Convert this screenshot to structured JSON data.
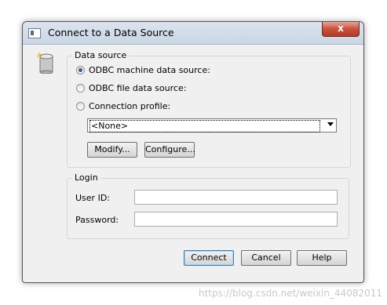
{
  "window": {
    "title": "Connect to a Data Source",
    "close_glyph": "x"
  },
  "data_source": {
    "group_label": "Data source",
    "options": [
      {
        "label": "ODBC machine data source:",
        "selected": true
      },
      {
        "label": "ODBC file data source:",
        "selected": false
      },
      {
        "label": "Connection profile:",
        "selected": false
      }
    ],
    "profile_value": "<None>",
    "modify_label": "Modify...",
    "configure_label": "Configure..."
  },
  "login": {
    "group_label": "Login",
    "user_id_label": "User ID:",
    "password_label": "Password:",
    "user_id_value": "",
    "password_value": ""
  },
  "footer": {
    "connect_label": "Connect",
    "cancel_label": "Cancel",
    "help_label": "Help"
  },
  "watermark": "https://blog.csdn.net/weixin_44082011"
}
